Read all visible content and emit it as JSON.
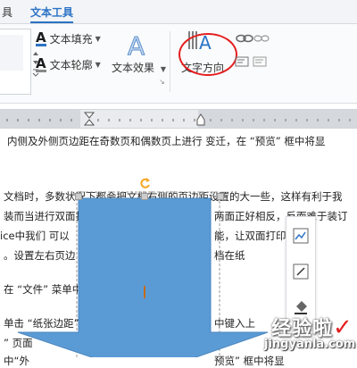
{
  "ribbon": {
    "tabs": [
      {
        "label": "具"
      },
      {
        "label": "文本工具"
      }
    ],
    "text_fill_label": "文本填充",
    "text_outline_label": "文本轮廓",
    "text_effect_label": "文本效果",
    "text_direction_label": "文字方向",
    "icons": [
      "text-fill-icon",
      "text-outline-icon",
      "text-effect-icon",
      "text-direction-icon",
      "link-icon",
      "unlink-icon",
      "align-left-icon",
      "align-right-icon"
    ]
  },
  "document": {
    "lines": [
      "内侧及外侧页边距在奇数页和偶数页上进行 变迁，在 “预览” 框中将显",
      "文档时，多数状况下都会把文档右侧的页边距设置的大一些，这样有利于我",
      "装而当进行双面打印",
      "ice中我们 可以",
      "。设置左右页边",
      "在 “文件” 菜单中",
      "单击 “纸张边距”",
      "” 页面",
      "中“外",
      "两面正好相反，反而难于装订",
      "能，让双面打印",
      "档在纸",
      "中键入上",
      "预览” 框中将显"
    ]
  },
  "watermark": {
    "main": "经验啦",
    "check": "✓",
    "url": "jingyanla.com"
  },
  "colors": {
    "accent": "#2b73c5",
    "shape_fill": "#5b9bd5",
    "highlight_circle": "#e41e1e",
    "rotate_handle": "#f5a623"
  }
}
